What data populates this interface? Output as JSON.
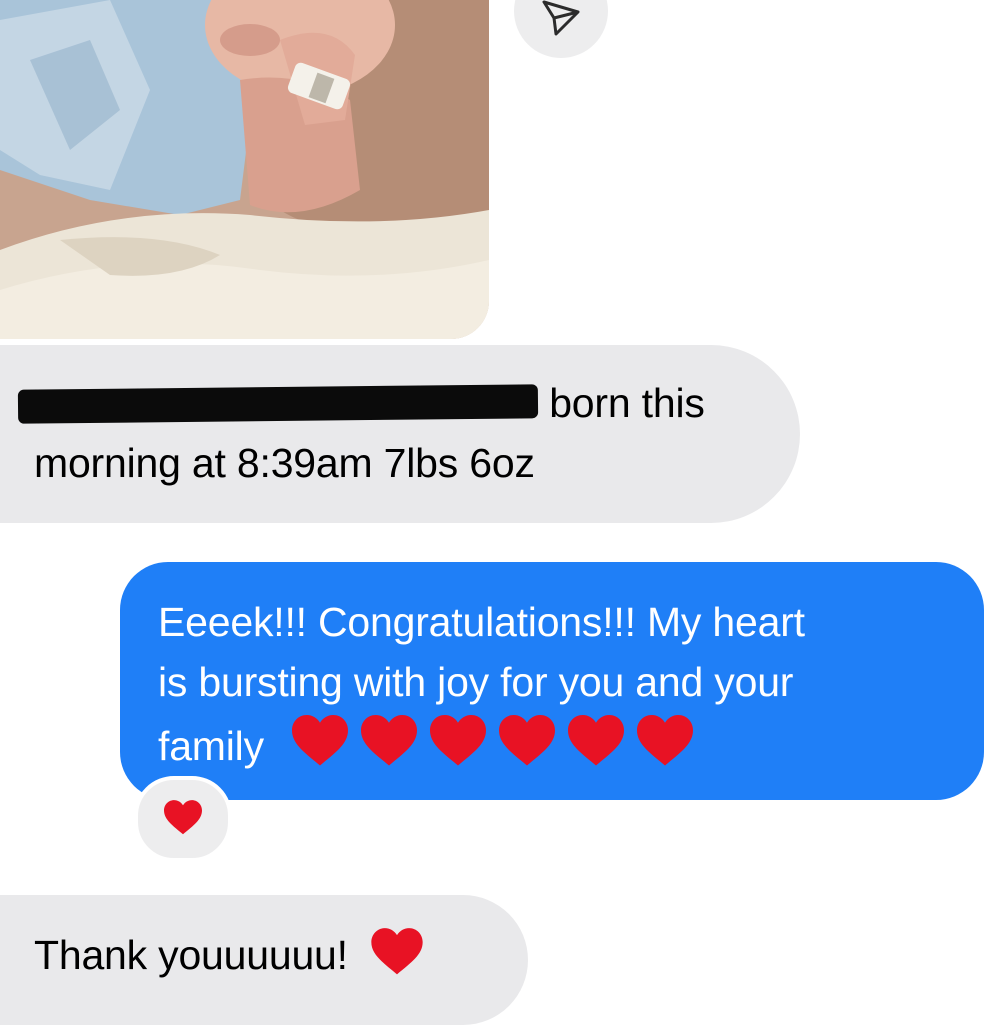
{
  "thread": {
    "photo": {
      "description_icon": "baby-photo-icon"
    },
    "share_icon": "send-arrow-icon",
    "messages": [
      {
        "sender": "incoming",
        "redacted": true,
        "line1_visible_text": "born this",
        "line2": "morning at 8:39am 7lbs 6oz"
      },
      {
        "sender": "outgoing",
        "line1": "Eeeek!!! Congratulations!!! My heart",
        "line2": "is bursting with joy for you and your",
        "line3": "family",
        "emoji": "❤️❤️❤️❤️❤️❤️",
        "reaction": "❤️"
      },
      {
        "sender": "incoming",
        "text": "Thank youuuuuu!",
        "emoji": "❤️"
      }
    ]
  },
  "colors": {
    "incoming_bubble": "#e9e9eb",
    "outgoing_bubble": "#1f7ff7",
    "heart": "#e81224"
  }
}
